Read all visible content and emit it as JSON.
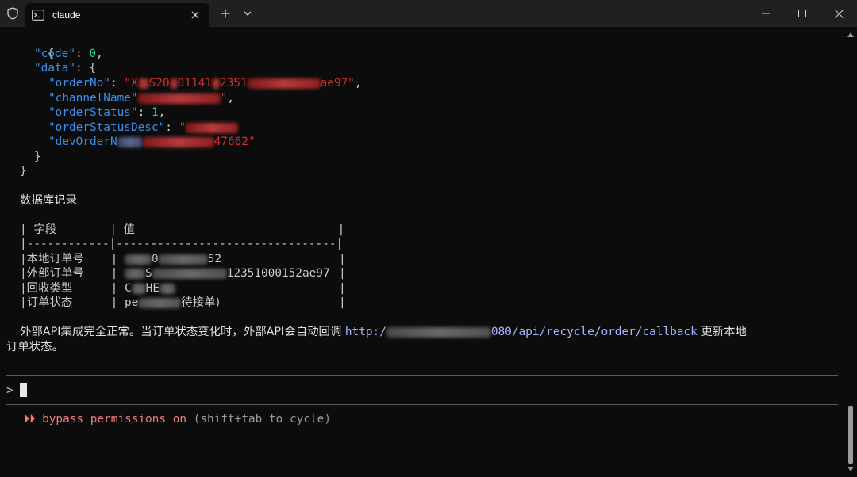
{
  "window": {
    "tab_title": "claude",
    "icons": {
      "shield": "shield-icon",
      "tab": "terminal-icon",
      "close": "close-icon",
      "new_tab": "plus-icon",
      "dropdown": "chevron-down-icon",
      "minimize": "minimize-icon",
      "maximize": "maximize-icon",
      "window_close": "close-icon"
    }
  },
  "json_output": {
    "open_brace": "{",
    "code_key": "\"code\"",
    "code_value": "0",
    "data_key": "\"data\"",
    "data_open": "{",
    "order_no_key": "\"orderNo\"",
    "order_no_head": "\"X",
    "order_no_mid1": "S20",
    "order_no_mid2": "01141",
    "order_no_mid3": "2351",
    "order_no_tail": "ae97\"",
    "channel_name_key": "\"channelName\"",
    "channel_name_tail": "\"",
    "order_status_key": "\"orderStatus\"",
    "order_status_value": "1",
    "order_status_desc_key": "\"orderStatusDesc\"",
    "order_status_desc_head": "\"",
    "dev_order_key_visible": "\"devOrderN",
    "dev_order_tail": "47662\"",
    "data_close": "}",
    "close_brace": "}"
  },
  "db_section": {
    "heading": "数据库记录",
    "col_field": "字段",
    "col_value": "值",
    "separator": "|------------|--------------------------------|",
    "rows": [
      {
        "field": "本地订单号",
        "value_visible_1": "0",
        "value_visible_2": "52"
      },
      {
        "field": "外部订单号",
        "value_visible_1": "S",
        "value_visible_2": "12351000152ae97"
      },
      {
        "field": "回收类型",
        "value_visible_1": "C",
        "value_visible_2": "HE"
      },
      {
        "field": "订单状态",
        "value_visible_1": "pe",
        "value_visible_2": "待接单)"
      }
    ]
  },
  "summary": {
    "text_before": "外部API集成完全正常。当订单状态变化时，外部API会自动回调 ",
    "url_head": "http:/",
    "url_tail": "080/api/recycle/order/callback",
    "text_after": " 更新本地",
    "text_line2": "订单状态。"
  },
  "input": {
    "prompt": ">"
  },
  "status": {
    "arrows": "⏵⏵",
    "mode": "bypass permissions on",
    "hint": "(shift+tab to cycle)"
  },
  "colors": {
    "background": "#0c0c0c",
    "titlebar": "#202020",
    "key": "#3b8eea",
    "string": "#cd3131",
    "number": "#23d18b",
    "url": "#a9b7ff",
    "bypass": "#f47b7b"
  }
}
